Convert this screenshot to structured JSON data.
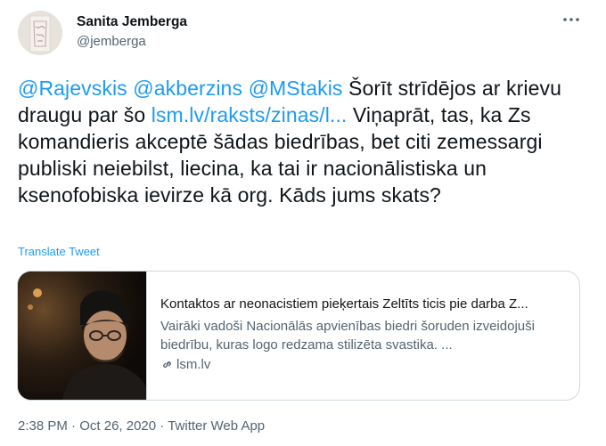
{
  "author": {
    "name": "Sanita Jemberga",
    "handle": "@jemberga"
  },
  "tweet": {
    "mentions": [
      "@Rajevskis",
      "@akberzins",
      "@MStakis"
    ],
    "text_before_link": " Šorīt strīdējos ar krievu draugu par šo ",
    "link": "lsm.lv/raksts/zinas/l...",
    "text_after_link": " Viņaprāt, tas, ka Zs komandieris akceptē šādas biedrības, bet citi zemessargi publiski neiebilst, liecina, ka tai ir nacionālistiska un ksenofobiska ievirze kā org. Kāds jums skats?",
    "translate_label": "Translate Tweet"
  },
  "card": {
    "title": "Kontaktos ar neonacistiem pieķertais Zeltīts ticis pie darba Z...",
    "description": "Vairāki vadoši Nacionālās apvienības biedri šoruden izveidojuši biedrību, kuras logo redzama stilizēta svastika. ...",
    "domain": "lsm.lv"
  },
  "meta": {
    "time": "2:38 PM",
    "separator": " · ",
    "date": "Oct 26, 2020",
    "source": "Twitter Web App"
  },
  "colors": {
    "link": "#1d9bf0",
    "secondary_text": "#536471",
    "border": "#cfd9de"
  }
}
